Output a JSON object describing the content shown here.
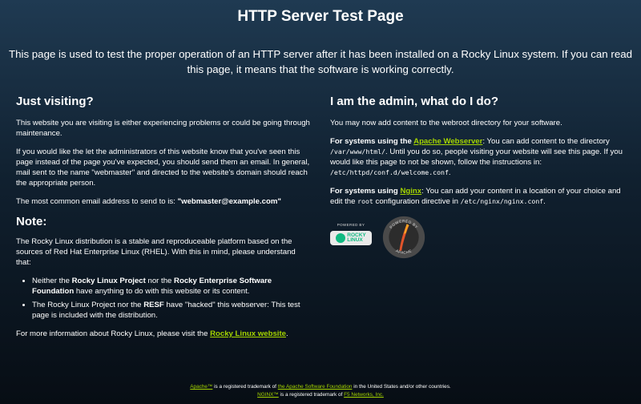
{
  "header": {
    "title": "HTTP Server Test Page",
    "intro": "This page is used to test the proper operation of an HTTP server after it has been installed on a Rocky Linux system. If you can read this page, it means that the software is working correctly."
  },
  "left": {
    "heading": "Just visiting?",
    "p1": "This website you are visiting is either experiencing problems or could be going through maintenance.",
    "p2": "If you would like the let the administrators of this website know that you've seen this page instead of the page you've expected, you should send them an email. In general, mail sent to the name \"webmaster\" and directed to the website's domain should reach the appropriate person.",
    "p3_prefix": "The most common email address to send to is: ",
    "p3_email": "\"webmaster@example.com\"",
    "note_heading": "Note:",
    "note_p": "The Rocky Linux distribution is a stable and reproduceable platform based on the sources of Red Hat Enterprise Linux (RHEL). With this in mind, please understand that:",
    "bullets": [
      {
        "a": "Neither the ",
        "b1": "Rocky Linux Project",
        "c": " nor the ",
        "b2": "Rocky Enterprise Software Foundation",
        "d": " have anything to do with this website or its content."
      },
      {
        "a": "The Rocky Linux Project nor the ",
        "b1": "RESF",
        "c": " have \"hacked\" this webserver: This test page is included with the distribution."
      }
    ],
    "more_prefix": "For more information about Rocky Linux, please visit the ",
    "more_link": "Rocky Linux website",
    "more_suffix": "."
  },
  "right": {
    "heading": "I am the admin, what do I do?",
    "p1": "You may now add content to the webroot directory for your software.",
    "apache": {
      "bold_prefix": "For systems using the ",
      "link": "Apache Webserver",
      "t1": ": You can add content to the directory ",
      "code1": "/var/www/html/",
      "t2": ". Until you do so, people visiting your website will see this page. If you would like this page to not be shown, follow the instructions in: ",
      "code2": "/etc/httpd/conf.d/welcome.conf",
      "t3": "."
    },
    "nginx": {
      "bold_prefix": "For systems using ",
      "link": "Nginx",
      "t1": ": You can add your content in a location of your choice and edit the ",
      "code1": "root",
      "t2": " configuration directive in ",
      "code2": "/etc/nginx/nginx.conf",
      "t3": "."
    },
    "rocky_badge": {
      "powered": "POWERED BY",
      "line1": "ROCKY",
      "line2": "LINUX"
    },
    "apache_badge": {
      "top": "POWERED BY",
      "bottom": "APACHE"
    }
  },
  "footer": {
    "line1": {
      "link1": "Apache™",
      "t1": " is a registered trademark of ",
      "link2": "the Apache Software Foundation",
      "t2": " in the United States and/or other countries."
    },
    "line2": {
      "link1": "NGINX™",
      "t1": " is a registered trademark of ",
      "link2": "F5 Networks, Inc.",
      "t2": ""
    }
  },
  "colors": {
    "link": "#a4d400",
    "rocky_green": "#10b981",
    "background_top": "#1f3a52",
    "background_bottom": "#070d14"
  }
}
